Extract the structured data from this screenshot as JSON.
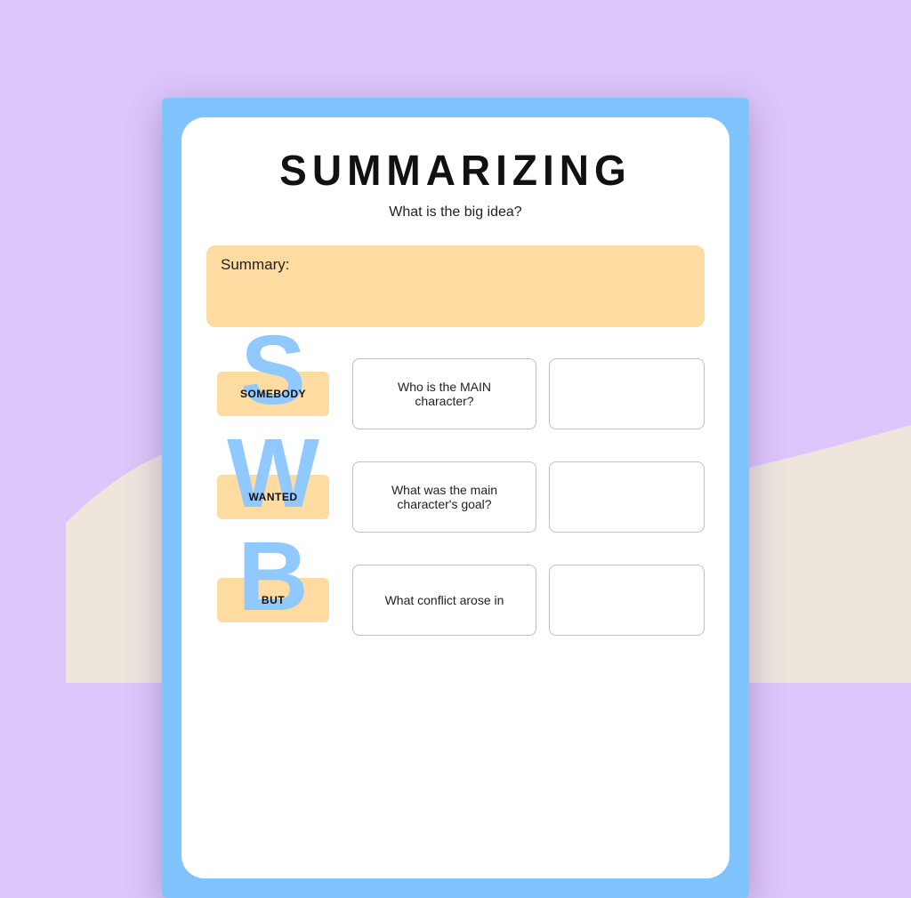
{
  "title": "SUMMARIZING",
  "subtitle": "What is the big idea?",
  "summary_label": "Summary:",
  "rows": [
    {
      "letter": "S",
      "name": "SOMEBODY",
      "prompt": "Who is the MAIN character?"
    },
    {
      "letter": "W",
      "name": "WANTED",
      "prompt": "What was the main character's goal?"
    },
    {
      "letter": "B",
      "name": "BUT",
      "prompt": "What conflict arose in"
    }
  ]
}
